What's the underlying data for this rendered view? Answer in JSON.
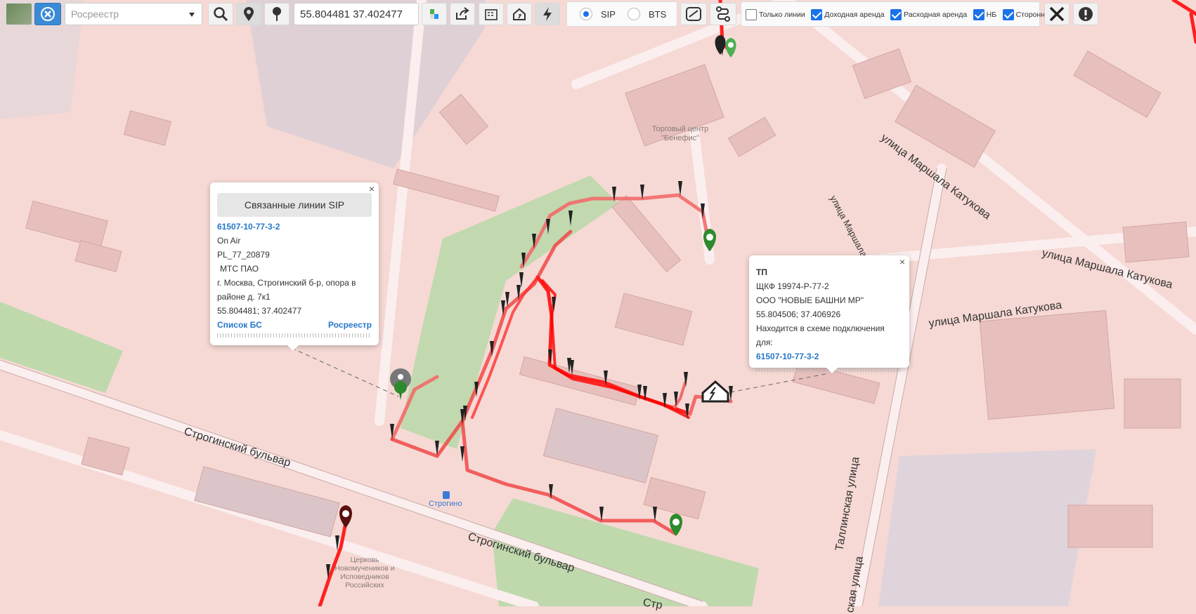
{
  "toolbar": {
    "source_select": "Росреестр",
    "coords_value": "55.804481 37.402477",
    "radio_sip": "SIP",
    "radio_bts": "BTS",
    "filters": [
      "Только линии",
      "Доходная аренда",
      "Расходная аренда",
      "НБ",
      "Сторонний"
    ],
    "filter_checked": [
      false,
      true,
      true,
      true,
      true
    ]
  },
  "popup_left": {
    "header": "Связанные линии SIP",
    "id_link": "61507-10-77-3-2",
    "status": "On Air",
    "code": "PL_77_20879",
    "operator": "МТС ПАО",
    "address": "г. Москва, Строгинский б-р, опора в районе д. 7к1",
    "coords": "55.804481; 37.402477",
    "link_list": "Список БС",
    "link_rosreestr": "Росреестр",
    "close": "×"
  },
  "popup_right": {
    "title": "ТП",
    "code": "ЩКФ 19974-Р-77-2",
    "org": "ООО \"НОВЫЕ БАШНИ МР\"",
    "coords": "55.804506; 37.406926",
    "note": "Находится в схеме подключения для:",
    "id_link": "61507-10-77-3-2",
    "close": "×"
  },
  "map_labels": {
    "mall": "Торговый центр \"Бенефис\"",
    "street_katukova_1": "улица Маршала Катукова",
    "street_katukova_2": "улица Маршала Катукова",
    "street_katukova_3": "улица Маршала Катукова",
    "street_katukova_4": "улица Маршала",
    "street_strog_1": "Строгинский бульвар",
    "street_strog_2": "Строгинский бульвар",
    "street_strog_3": "Стр",
    "street_tallin_1": "Таллинская улица",
    "street_tallin_2": "ская улица",
    "metro": "Строгино",
    "church": "Церковь Новомучеников и Исповедников Российских"
  }
}
